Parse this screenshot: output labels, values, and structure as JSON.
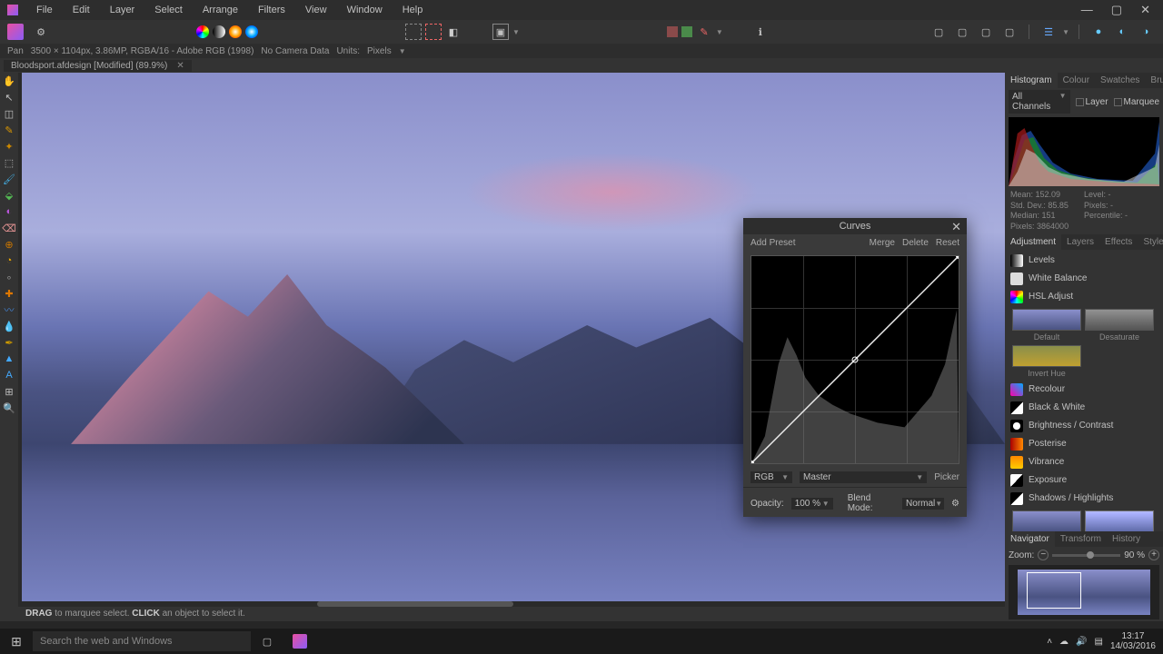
{
  "menu": [
    "File",
    "Edit",
    "Layer",
    "Select",
    "Arrange",
    "Filters",
    "View",
    "Window",
    "Help"
  ],
  "doc_info": {
    "tool": "Pan",
    "dims": "3500 × 1104px, 3.86MP, RGBA/16 - Adobe RGB (1998)",
    "camera": "No Camera Data",
    "units_label": "Units:",
    "units_value": "Pixels"
  },
  "tab": {
    "name": "Bloodsport.afdesign [Modified] (89.9%)"
  },
  "status_hint": {
    "drag": "DRAG",
    "drag_txt": " to marquee select. ",
    "click": "CLICK",
    "click_txt": " an object to select it."
  },
  "histogram": {
    "tabs": [
      "Histogram",
      "Colour",
      "Swatches",
      "Brushes"
    ],
    "channel": "All Channels",
    "layer": "Layer",
    "marquee": "Marquee",
    "stats": {
      "mean_l": "Mean:",
      "mean_v": "152.09",
      "sd_l": "Std. Dev.:",
      "sd_v": "85.85",
      "med_l": "Median:",
      "med_v": "151",
      "px_l": "Pixels:",
      "px_v": "3864000",
      "lvl": "Level: -",
      "pc": "Pixels: -",
      "pt": "Percentile: -"
    }
  },
  "adj": {
    "tabs": [
      "Adjustment",
      "Layers",
      "Effects",
      "Styles"
    ],
    "items": [
      "Levels",
      "White Balance",
      "HSL Adjust",
      "Recolour",
      "Black & White",
      "Brightness / Contrast",
      "Posterise",
      "Vibrance",
      "Exposure",
      "Shadows / Highlights"
    ],
    "presets": [
      "Default",
      "Desaturate",
      "Invert Hue"
    ]
  },
  "nav": {
    "tabs": [
      "Navigator",
      "Transform",
      "History"
    ],
    "zoom_l": "Zoom:",
    "zoom_v": "90 %"
  },
  "curves": {
    "title": "Curves",
    "add_preset": "Add Preset",
    "merge": "Merge",
    "delete": "Delete",
    "reset": "Reset",
    "ch": "RGB",
    "master": "Master",
    "picker": "Picker",
    "opacity_l": "Opacity:",
    "opacity_v": "100 %",
    "blend_l": "Blend Mode:",
    "blend_v": "Normal"
  },
  "taskbar": {
    "search_ph": "Search the web and Windows",
    "time": "13:17",
    "date": "14/03/2016"
  },
  "colors": {
    "accent_pink": "#e950a1",
    "accent_purple": "#8b5cf6"
  }
}
